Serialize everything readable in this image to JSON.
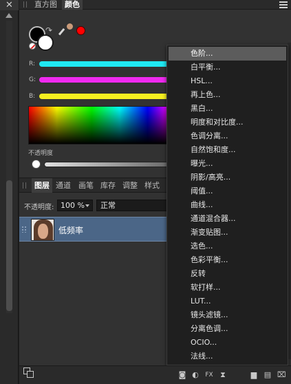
{
  "left_strip": {
    "close_glyph": "✕"
  },
  "top_tabs": {
    "histogram": "直方图",
    "color": "颜色"
  },
  "color_panel": {
    "r_label": "R:",
    "g_label": "G:",
    "b_label": "B:",
    "opacity_label": "不透明度",
    "picked_color": "#ff0000"
  },
  "layers": {
    "tabs": [
      {
        "label": "图层",
        "active": true
      },
      {
        "label": "通道",
        "active": false
      },
      {
        "label": "画笔",
        "active": false
      },
      {
        "label": "库存",
        "active": false
      },
      {
        "label": "调整",
        "active": false
      },
      {
        "label": "样式",
        "active": false
      }
    ],
    "opacity_label": "不透明度:",
    "opacity_value": "100 %",
    "blend_mode": "正常",
    "layer_name": "低频率"
  },
  "menu": {
    "items": [
      "色阶...",
      "白平衡...",
      "HSL...",
      "再上色...",
      "黑白...",
      "明度和对比度...",
      "色调分离...",
      "自然饱和度...",
      "曝光...",
      "阴影/高亮...",
      "阈值...",
      "曲线...",
      "通道混合器...",
      "渐变贴图...",
      "选色...",
      "色彩平衡...",
      "反转",
      "软打样...",
      "LUT...",
      "镜头滤镜...",
      "分离色调...",
      "OCIO...",
      "法线..."
    ],
    "highlighted_index": 0
  },
  "bottom_bar": {
    "fx_label": "FX"
  }
}
